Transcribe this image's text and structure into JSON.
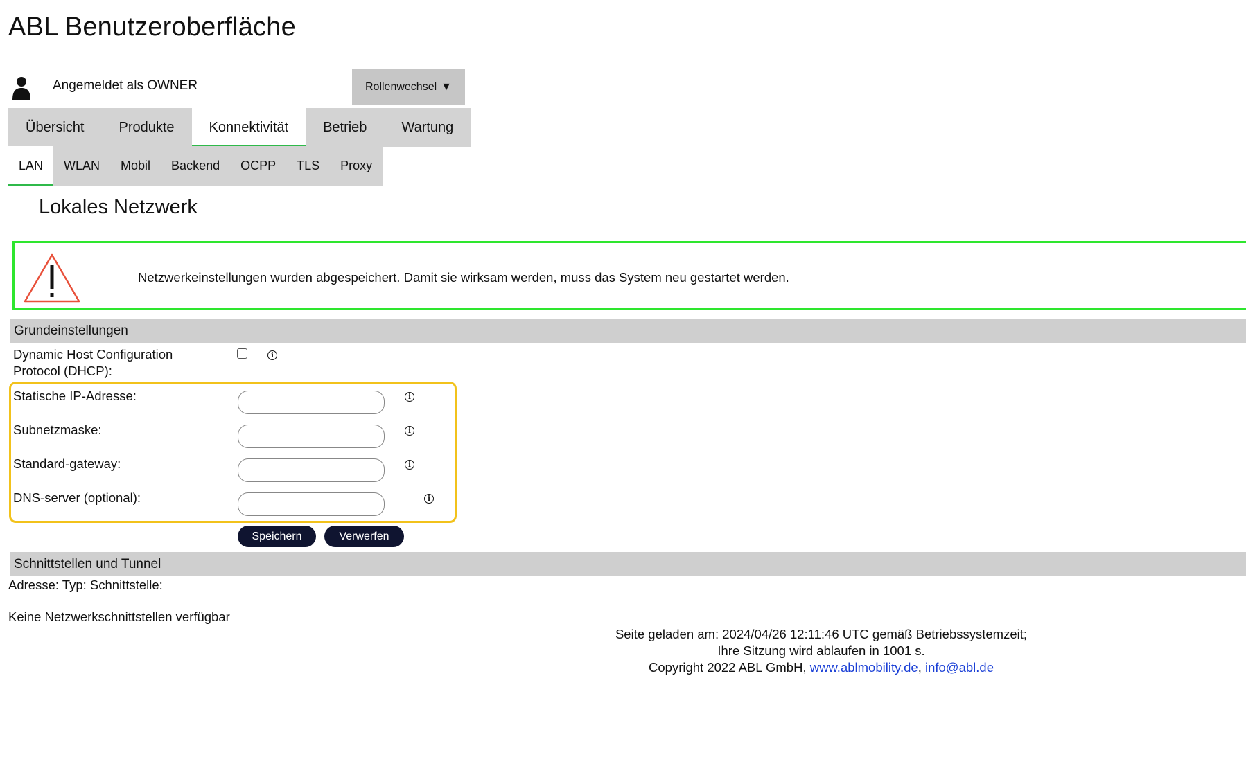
{
  "app": {
    "title": "ABL Benutzeroberfläche"
  },
  "user": {
    "label": "Angemeldet als OWNER",
    "icon": "user-icon"
  },
  "role_switch": {
    "label": "Rollenwechsel",
    "caret": "▼"
  },
  "main_tabs": [
    {
      "label": "Übersicht",
      "active": false
    },
    {
      "label": "Produkte",
      "active": false
    },
    {
      "label": "Konnektivität",
      "active": true
    },
    {
      "label": "Betrieb",
      "active": false
    },
    {
      "label": "Wartung",
      "active": false
    }
  ],
  "sub_tabs": [
    {
      "label": "LAN",
      "active": true
    },
    {
      "label": "WLAN",
      "active": false
    },
    {
      "label": "Mobil",
      "active": false
    },
    {
      "label": "Backend",
      "active": false
    },
    {
      "label": "OCPP",
      "active": false
    },
    {
      "label": "TLS",
      "active": false
    },
    {
      "label": "Proxy",
      "active": false
    }
  ],
  "page": {
    "title": "Lokales Netzwerk"
  },
  "alert": {
    "icon": "warning-icon",
    "text": "Netzwerkeinstellungen wurden abgespeichert. Damit sie wirksam werden, muss das System neu gestartet werden.",
    "border_color": "#2ee62e"
  },
  "basic_settings": {
    "header": "Grundeinstellungen",
    "dhcp": {
      "label_line1": "Dynamic Host Configuration",
      "label_line2": "Protocol (DHCP):",
      "checked": false
    },
    "fields": {
      "ip": {
        "label": "Statische IP-Adresse:",
        "value": ""
      },
      "mask": {
        "label": "Subnetzmaske:",
        "value": ""
      },
      "gateway": {
        "label": "Standard-gateway:",
        "value": ""
      },
      "dns": {
        "label": "DNS-server (optional):",
        "value": ""
      }
    },
    "highlight_color": "#f2c21b",
    "save_label": "Speichern",
    "discard_label": "Verwerfen"
  },
  "interfaces": {
    "header": "Schnittstellen und Tunnel",
    "columns": "Adresse: Typ: Schnittstelle:",
    "empty_text": "Keine Netzwerkschnittstellen verfügbar"
  },
  "footer": {
    "loaded": "Seite geladen am: 2024/04/26 12:11:46 UTC gemäß Betriebssystemzeit;",
    "session": "Ihre Sitzung wird ablaufen in 1001 s.",
    "copyright": "Copyright 2022 ABL GmbH,",
    "sep": ",",
    "website": "www.ablmobility.de",
    "email": "info@abl.de"
  },
  "colors": {
    "active_tab_underline": "#2fb94a",
    "tab_bg": "#d3d3d3",
    "button_dark": "#0f1430",
    "link": "#1a3fd6"
  }
}
